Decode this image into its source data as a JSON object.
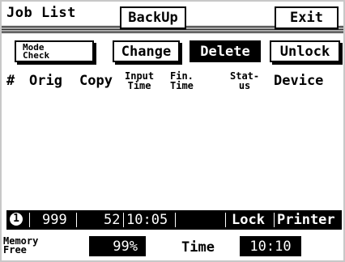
{
  "title": "Job List",
  "buttons": {
    "backup": "BackUp",
    "exit": "Exit",
    "mode_line1": "Mode",
    "mode_line2": "Check",
    "change": "Change",
    "delete": "Delete",
    "unlock": "Unlock"
  },
  "columns": {
    "num": "#",
    "orig": "Orig",
    "copy": "Copy",
    "input_1": "Input",
    "input_2": "Time",
    "fin_1": "Fin.",
    "fin_2": "Time",
    "stat_1": "Stat-",
    "stat_2": "us",
    "device": "Device"
  },
  "job": {
    "index": "1",
    "orig": "999",
    "copy": "52",
    "input_time": "10:05",
    "fin_time": "",
    "status": "Lock",
    "device": "Printer"
  },
  "footer": {
    "memory_label_1": "Memory",
    "memory_label_2": "Free",
    "memory_value": "99%",
    "time_label": "Time",
    "time_value": "10:10"
  }
}
